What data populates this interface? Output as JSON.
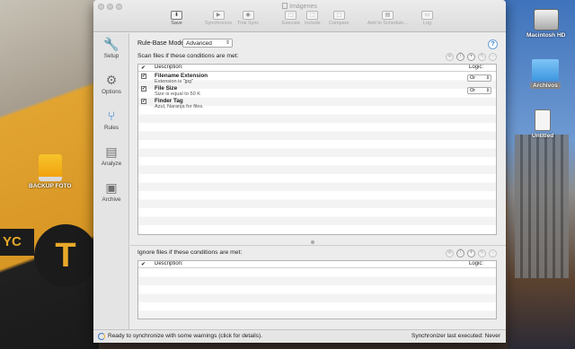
{
  "desktop": {
    "left_icons": [
      {
        "label": "BACKUP FOTO"
      }
    ],
    "right_icons": [
      {
        "label": "Macintosh HD"
      },
      {
        "label": "Archivos"
      },
      {
        "label": "Untitled"
      }
    ],
    "background_text": {
      "taxi_sign": "YC",
      "taxi_letter": "T"
    }
  },
  "window": {
    "title": "Imágenes",
    "toolbar": [
      {
        "label": "Save",
        "icon": "save-icon",
        "glyph": "⬇",
        "enabled": true
      },
      {
        "label": "Synchronize",
        "icon": "play-icon",
        "glyph": "▶",
        "enabled": false
      },
      {
        "label": "Trial Sync",
        "icon": "trial-icon",
        "glyph": "◉",
        "enabled": false
      },
      {
        "label": "Execute",
        "icon": "execute-icon",
        "glyph": "⬚",
        "enabled": false
      },
      {
        "label": "Include",
        "icon": "include-icon",
        "glyph": "⬚",
        "enabled": false
      },
      {
        "label": "Compare",
        "icon": "compare-icon",
        "glyph": "⬚",
        "enabled": false
      },
      {
        "label": "Add to Schedule...",
        "icon": "schedule-icon",
        "glyph": "▤",
        "enabled": false
      },
      {
        "label": "Log",
        "icon": "log-icon",
        "glyph": "▭",
        "enabled": false
      }
    ],
    "sidebar": [
      {
        "label": "Setup",
        "icon": "wrench-icon",
        "glyph": "🔧"
      },
      {
        "label": "Options",
        "icon": "gear-icon",
        "glyph": "⚙"
      },
      {
        "label": "Rules",
        "icon": "rules-icon",
        "glyph": "⑂"
      },
      {
        "label": "Analyze",
        "icon": "analyze-icon",
        "glyph": "▤"
      },
      {
        "label": "Archive",
        "icon": "archive-icon",
        "glyph": "▣"
      }
    ],
    "active_sidebar": "Rules",
    "rule_base_mode": {
      "label": "Rule-Base Mode:",
      "value": "Advanced"
    },
    "help": "?",
    "scan_section": {
      "label": "Scan files if these conditions are met:",
      "columns": {
        "check": "✔",
        "description": "Description:",
        "logic": "Logic:"
      },
      "rules": [
        {
          "checked": true,
          "name": "Filename Extension",
          "detail": "Extension is \"jpg\"",
          "logic": "Or"
        },
        {
          "checked": true,
          "name": "File Size",
          "detail": "Size is equal to 50 K",
          "logic": "Or"
        },
        {
          "checked": true,
          "name": "Finder Tag",
          "detail": "Azul, Naranja for files.",
          "logic": ""
        }
      ]
    },
    "ignore_section": {
      "label": "Ignore files if these conditions are met:",
      "columns": {
        "check": "✔",
        "description": "Description:",
        "logic": "Logic:"
      },
      "rules": []
    },
    "row_controls": [
      "actions-icon",
      "info-icon",
      "add-icon",
      "edit-icon",
      "remove-icon"
    ],
    "status": {
      "message": "Ready to synchronize with some warnings (click for details).",
      "last_executed_label": "Synchronizer last executed:",
      "last_executed_value": "Never"
    }
  }
}
